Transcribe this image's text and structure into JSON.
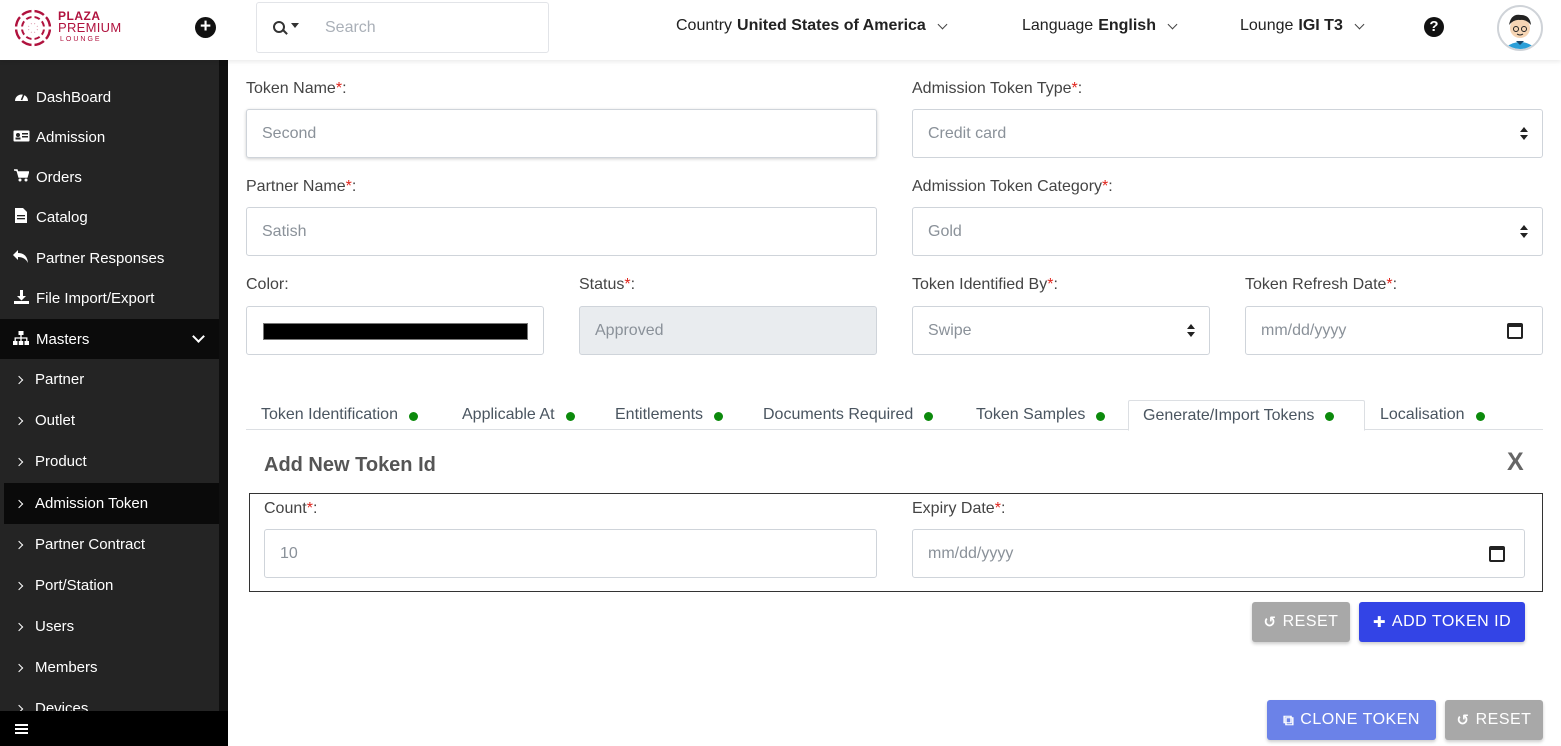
{
  "header": {
    "logo": {
      "line1": "PLAZA",
      "line2": "PREMIUM",
      "line3": "LOUNGE"
    },
    "search": {
      "placeholder": "Search"
    },
    "country": {
      "label": "Country",
      "value": "United States of America"
    },
    "language": {
      "label": "Language",
      "value": "English"
    },
    "lounge": {
      "label": "Lounge",
      "value": "IGI T3"
    }
  },
  "sidebar": {
    "items": [
      {
        "label": "DashBoard",
        "icon": "dashboard-icon"
      },
      {
        "label": "Admission",
        "icon": "id-card-icon"
      },
      {
        "label": "Orders",
        "icon": "cart-icon"
      },
      {
        "label": "Catalog",
        "icon": "document-icon"
      },
      {
        "label": "Partner Responses",
        "icon": "reply-all-icon"
      },
      {
        "label": "File Import/Export",
        "icon": "download-icon"
      },
      {
        "label": "Masters",
        "icon": "sitemap-icon"
      }
    ],
    "sub_items": [
      {
        "label": "Partner"
      },
      {
        "label": "Outlet"
      },
      {
        "label": "Product"
      },
      {
        "label": "Admission Token",
        "active": true
      },
      {
        "label": "Partner Contract"
      },
      {
        "label": "Port/Station"
      },
      {
        "label": "Users"
      },
      {
        "label": "Members"
      },
      {
        "label": "Devices"
      }
    ]
  },
  "form": {
    "token_name": {
      "label": "Token Name",
      "value": "Second"
    },
    "token_type": {
      "label": "Admission Token Type",
      "value": "Credit card"
    },
    "partner_name": {
      "label": "Partner Name",
      "value": "Satish"
    },
    "token_category": {
      "label": "Admission Token Category",
      "value": "Gold"
    },
    "color": {
      "label": "Color:",
      "value": "#000000"
    },
    "status": {
      "label": "Status",
      "value": "Approved"
    },
    "identified_by": {
      "label": "Token Identified By",
      "value": "Swipe"
    },
    "refresh_date": {
      "label": "Token Refresh Date",
      "placeholder": "mm/dd/yyyy"
    }
  },
  "tabs": [
    {
      "label": "Token Identification"
    },
    {
      "label": "Applicable At"
    },
    {
      "label": "Entitlements"
    },
    {
      "label": "Documents Required"
    },
    {
      "label": "Token Samples"
    },
    {
      "label": "Generate/Import Tokens",
      "active": true
    },
    {
      "label": "Localisation"
    }
  ],
  "token_panel": {
    "title": "Add New Token Id",
    "close": "X",
    "count": {
      "label": "Count",
      "value": "10"
    },
    "expiry": {
      "label": "Expiry Date",
      "placeholder": "mm/dd/yyyy"
    },
    "reset_label": "RESET",
    "add_label": "ADD TOKEN ID"
  },
  "footer": {
    "clone_label": "CLONE TOKEN",
    "reset_label": "RESET"
  },
  "colors": {
    "brand": "#b0123e",
    "primary": "#3344e6",
    "required": "#e0241c",
    "status_dot": "#0c8a0c"
  }
}
